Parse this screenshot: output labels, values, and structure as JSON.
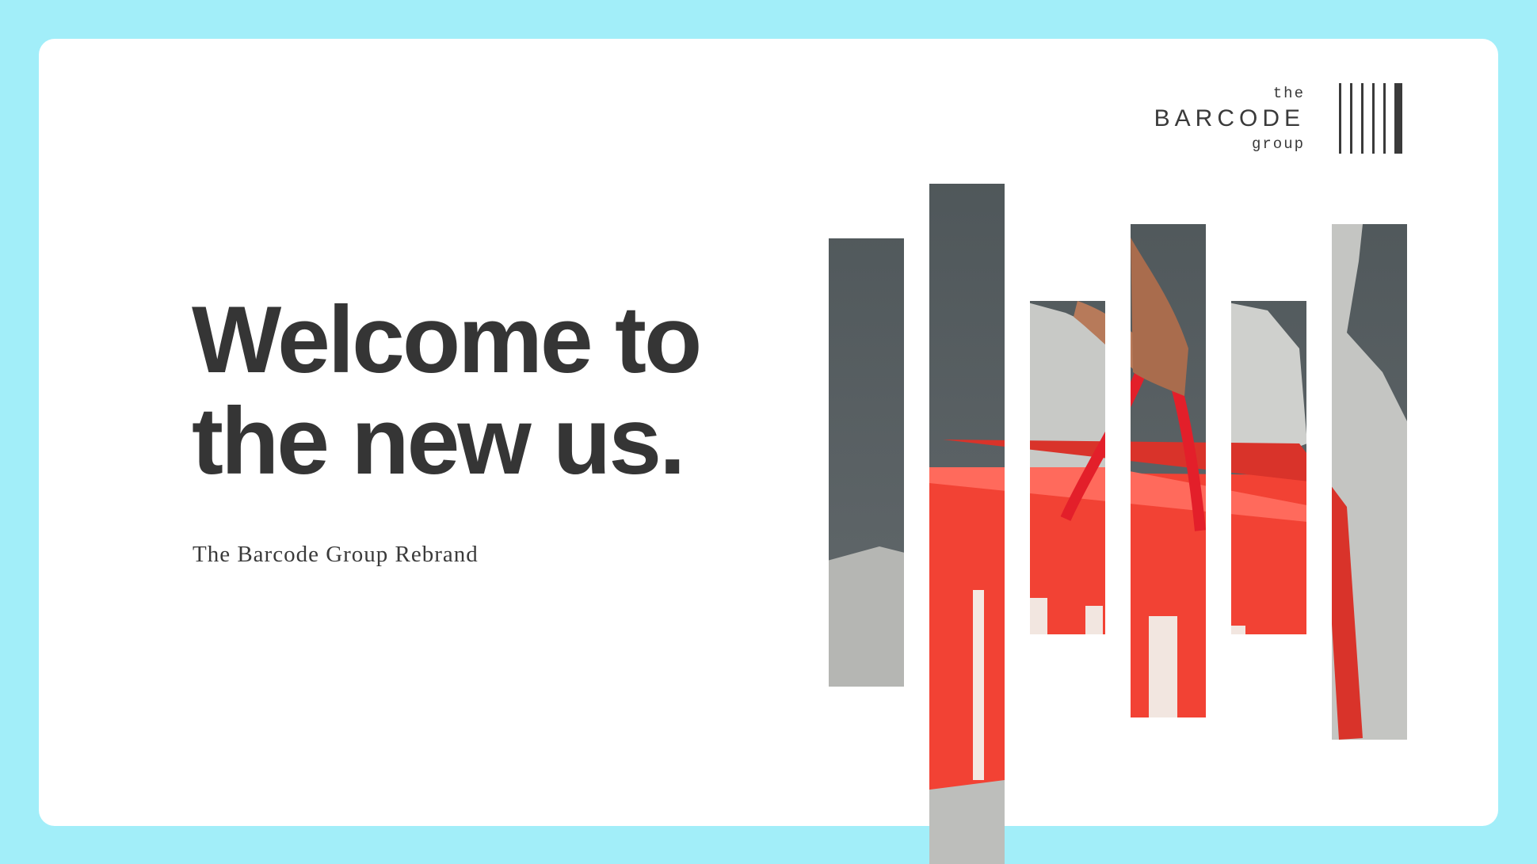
{
  "hero": {
    "headline_line1": "Welcome to",
    "headline_line2": "the new us.",
    "subtitle": "The Barcode Group Rebrand"
  },
  "logo": {
    "the": "the",
    "wordmark": "BARCODE",
    "group": "group"
  },
  "colors": {
    "background": "#a2eef9",
    "card": "#ffffff",
    "text": "#353535",
    "bag_red": "#f24234",
    "pavement": "#545b5e"
  },
  "image": {
    "subject": "hand holding red shopping bag",
    "strip_count": 6
  }
}
